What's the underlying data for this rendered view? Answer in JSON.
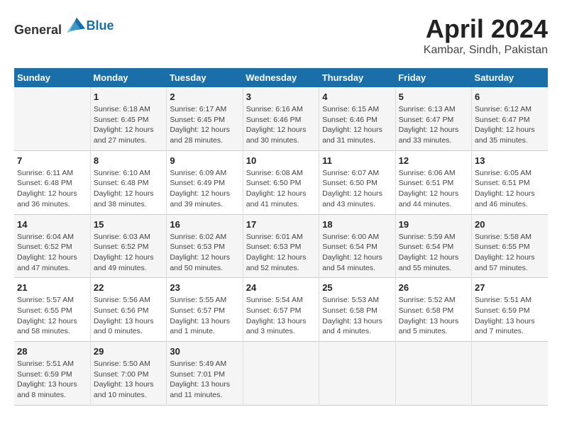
{
  "header": {
    "logo_general": "General",
    "logo_blue": "Blue",
    "title": "April 2024",
    "subtitle": "Kambar, Sindh, Pakistan"
  },
  "weekdays": [
    "Sunday",
    "Monday",
    "Tuesday",
    "Wednesday",
    "Thursday",
    "Friday",
    "Saturday"
  ],
  "weeks": [
    [
      {
        "day": "",
        "info": ""
      },
      {
        "day": "1",
        "info": "Sunrise: 6:18 AM\nSunset: 6:45 PM\nDaylight: 12 hours\nand 27 minutes."
      },
      {
        "day": "2",
        "info": "Sunrise: 6:17 AM\nSunset: 6:45 PM\nDaylight: 12 hours\nand 28 minutes."
      },
      {
        "day": "3",
        "info": "Sunrise: 6:16 AM\nSunset: 6:46 PM\nDaylight: 12 hours\nand 30 minutes."
      },
      {
        "day": "4",
        "info": "Sunrise: 6:15 AM\nSunset: 6:46 PM\nDaylight: 12 hours\nand 31 minutes."
      },
      {
        "day": "5",
        "info": "Sunrise: 6:13 AM\nSunset: 6:47 PM\nDaylight: 12 hours\nand 33 minutes."
      },
      {
        "day": "6",
        "info": "Sunrise: 6:12 AM\nSunset: 6:47 PM\nDaylight: 12 hours\nand 35 minutes."
      }
    ],
    [
      {
        "day": "7",
        "info": "Sunrise: 6:11 AM\nSunset: 6:48 PM\nDaylight: 12 hours\nand 36 minutes."
      },
      {
        "day": "8",
        "info": "Sunrise: 6:10 AM\nSunset: 6:48 PM\nDaylight: 12 hours\nand 38 minutes."
      },
      {
        "day": "9",
        "info": "Sunrise: 6:09 AM\nSunset: 6:49 PM\nDaylight: 12 hours\nand 39 minutes."
      },
      {
        "day": "10",
        "info": "Sunrise: 6:08 AM\nSunset: 6:50 PM\nDaylight: 12 hours\nand 41 minutes."
      },
      {
        "day": "11",
        "info": "Sunrise: 6:07 AM\nSunset: 6:50 PM\nDaylight: 12 hours\nand 43 minutes."
      },
      {
        "day": "12",
        "info": "Sunrise: 6:06 AM\nSunset: 6:51 PM\nDaylight: 12 hours\nand 44 minutes."
      },
      {
        "day": "13",
        "info": "Sunrise: 6:05 AM\nSunset: 6:51 PM\nDaylight: 12 hours\nand 46 minutes."
      }
    ],
    [
      {
        "day": "14",
        "info": "Sunrise: 6:04 AM\nSunset: 6:52 PM\nDaylight: 12 hours\nand 47 minutes."
      },
      {
        "day": "15",
        "info": "Sunrise: 6:03 AM\nSunset: 6:52 PM\nDaylight: 12 hours\nand 49 minutes."
      },
      {
        "day": "16",
        "info": "Sunrise: 6:02 AM\nSunset: 6:53 PM\nDaylight: 12 hours\nand 50 minutes."
      },
      {
        "day": "17",
        "info": "Sunrise: 6:01 AM\nSunset: 6:53 PM\nDaylight: 12 hours\nand 52 minutes."
      },
      {
        "day": "18",
        "info": "Sunrise: 6:00 AM\nSunset: 6:54 PM\nDaylight: 12 hours\nand 54 minutes."
      },
      {
        "day": "19",
        "info": "Sunrise: 5:59 AM\nSunset: 6:54 PM\nDaylight: 12 hours\nand 55 minutes."
      },
      {
        "day": "20",
        "info": "Sunrise: 5:58 AM\nSunset: 6:55 PM\nDaylight: 12 hours\nand 57 minutes."
      }
    ],
    [
      {
        "day": "21",
        "info": "Sunrise: 5:57 AM\nSunset: 6:55 PM\nDaylight: 12 hours\nand 58 minutes."
      },
      {
        "day": "22",
        "info": "Sunrise: 5:56 AM\nSunset: 6:56 PM\nDaylight: 13 hours\nand 0 minutes."
      },
      {
        "day": "23",
        "info": "Sunrise: 5:55 AM\nSunset: 6:57 PM\nDaylight: 13 hours\nand 1 minute."
      },
      {
        "day": "24",
        "info": "Sunrise: 5:54 AM\nSunset: 6:57 PM\nDaylight: 13 hours\nand 3 minutes."
      },
      {
        "day": "25",
        "info": "Sunrise: 5:53 AM\nSunset: 6:58 PM\nDaylight: 13 hours\nand 4 minutes."
      },
      {
        "day": "26",
        "info": "Sunrise: 5:52 AM\nSunset: 6:58 PM\nDaylight: 13 hours\nand 5 minutes."
      },
      {
        "day": "27",
        "info": "Sunrise: 5:51 AM\nSunset: 6:59 PM\nDaylight: 13 hours\nand 7 minutes."
      }
    ],
    [
      {
        "day": "28",
        "info": "Sunrise: 5:51 AM\nSunset: 6:59 PM\nDaylight: 13 hours\nand 8 minutes."
      },
      {
        "day": "29",
        "info": "Sunrise: 5:50 AM\nSunset: 7:00 PM\nDaylight: 13 hours\nand 10 minutes."
      },
      {
        "day": "30",
        "info": "Sunrise: 5:49 AM\nSunset: 7:01 PM\nDaylight: 13 hours\nand 11 minutes."
      },
      {
        "day": "",
        "info": ""
      },
      {
        "day": "",
        "info": ""
      },
      {
        "day": "",
        "info": ""
      },
      {
        "day": "",
        "info": ""
      }
    ]
  ]
}
